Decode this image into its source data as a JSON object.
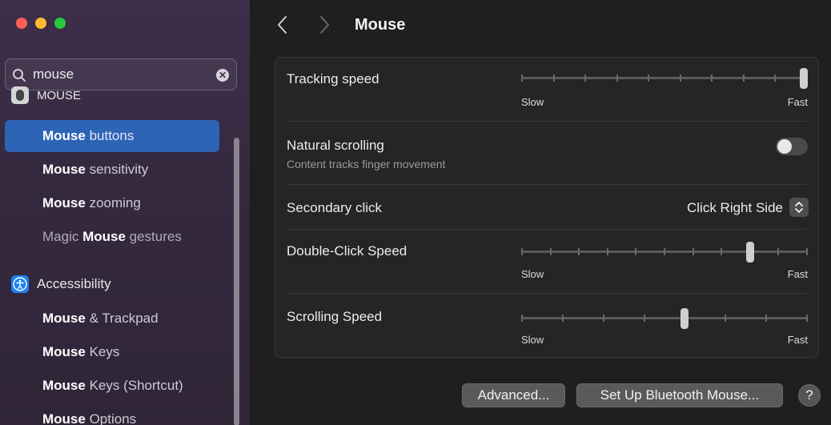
{
  "sidebar": {
    "search": {
      "value": "mouse",
      "placeholder": "Search"
    },
    "groups": [
      {
        "label": "Mouse",
        "icon": "mouse-icon"
      },
      {
        "label": "Accessibility",
        "icon": "accessibility-icon"
      }
    ],
    "items": [
      {
        "bold": "Mouse",
        "rest": " buttons",
        "selected": true
      },
      {
        "bold": "Mouse",
        "rest": " sensitivity"
      },
      {
        "bold": "Mouse",
        "rest": " zooming"
      },
      {
        "pre": "Magic ",
        "bold": "Mouse",
        "rest": " gestures"
      },
      {
        "bold": "Mouse",
        "rest": " & Trackpad"
      },
      {
        "bold": "Mouse",
        "rest": " Keys"
      },
      {
        "bold": "Mouse",
        "rest": " Keys (Shortcut)"
      },
      {
        "bold": "Mouse",
        "rest": " Options"
      }
    ]
  },
  "header": {
    "title": "Mouse"
  },
  "settings": {
    "tracking": {
      "label": "Tracking speed",
      "slow": "Slow",
      "fast": "Fast",
      "value": 1.0
    },
    "natural": {
      "label": "Natural scrolling",
      "sub": "Content tracks finger movement",
      "on": false
    },
    "secondary": {
      "label": "Secondary click",
      "value": "Click Right Side"
    },
    "doubleclick": {
      "label": "Double-Click Speed",
      "slow": "Slow",
      "fast": "Fast",
      "value": 0.8
    },
    "scrolling": {
      "label": "Scrolling Speed",
      "slow": "Slow",
      "fast": "Fast",
      "value": 0.57
    }
  },
  "buttons": {
    "advanced": "Advanced...",
    "bluetooth": "Set Up Bluetooth Mouse...",
    "help": "?"
  },
  "colors": {
    "accent": "#2e64b6",
    "sidebar_bg": "#3a2d46"
  }
}
